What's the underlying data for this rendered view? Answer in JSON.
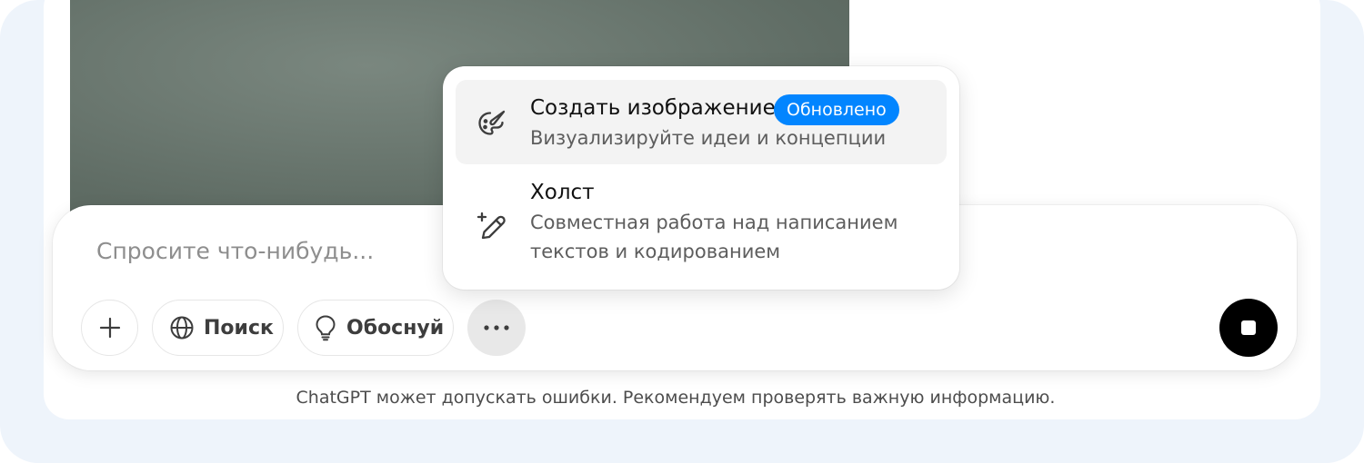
{
  "composer": {
    "placeholder": "Спросите что-нибудь...",
    "buttons": {
      "search_label": "Поиск",
      "reason_label": "Обоснуй"
    }
  },
  "tools_menu": {
    "items": [
      {
        "title": "Создать изображение",
        "badge": "Обновлено",
        "description": "Визуализируйте идеи и концепции",
        "icon": "palette-brush-icon"
      },
      {
        "title": "Холст",
        "description": "Совместная работа над написанием текстов и кодированием",
        "icon": "pencil-sparkle-icon"
      }
    ]
  },
  "footer": {
    "disclaimer": "ChatGPT может допускать ошибки. Рекомендуем проверять важную информацию."
  },
  "colors": {
    "badge": "#0285ff",
    "stop_button": "#000000",
    "frame_background": "#eef4fb"
  }
}
